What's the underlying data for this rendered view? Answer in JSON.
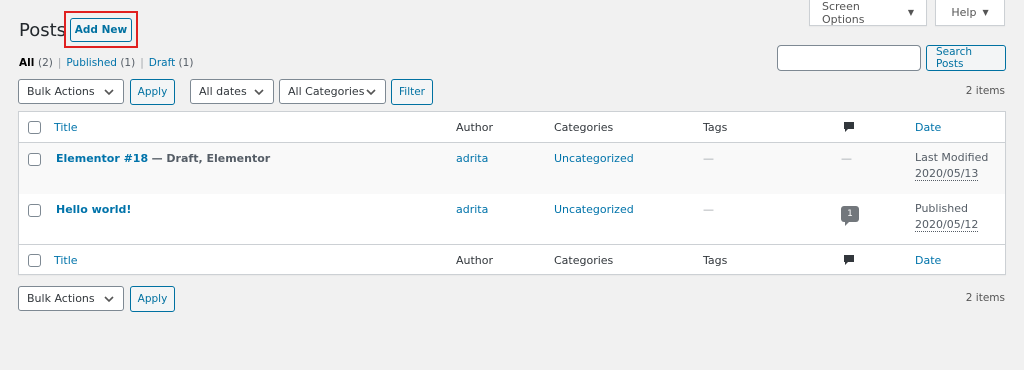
{
  "screen_meta": {
    "screen_options": "Screen Options",
    "help": "Help"
  },
  "heading": {
    "title": "Posts",
    "add_new": "Add New"
  },
  "views": {
    "all": {
      "label": "All",
      "count": "(2)"
    },
    "published": {
      "label": "Published",
      "count": "(1)"
    },
    "draft": {
      "label": "Draft",
      "count": "(1)"
    },
    "separator": "|"
  },
  "search": {
    "value": "",
    "button": "Search Posts"
  },
  "tablenav_top": {
    "bulk_actions": "Bulk Actions",
    "apply": "Apply",
    "dates": "All dates",
    "categories": "All Categories",
    "filter": "Filter",
    "items": "2 items"
  },
  "columns": {
    "title": "Title",
    "author": "Author",
    "categories": "Categories",
    "tags": "Tags",
    "date": "Date"
  },
  "rows": [
    {
      "title": "Elementor #18",
      "state": "— Draft, Elementor",
      "author": "adrita",
      "category": "Uncategorized",
      "tags": "—",
      "comments": "—",
      "date_status": "Last Modified",
      "date_value": "2020/05/13"
    },
    {
      "title": "Hello world!",
      "state": "",
      "author": "adrita",
      "category": "Uncategorized",
      "tags": "—",
      "comments": "1",
      "date_status": "Published",
      "date_value": "2020/05/12"
    }
  ],
  "tablenav_bottom": {
    "bulk_actions": "Bulk Actions",
    "apply": "Apply",
    "items": "2 items"
  },
  "colors": {
    "link": "#0073aa",
    "highlight_box": "#e02020",
    "button_border": "#0071a1"
  }
}
